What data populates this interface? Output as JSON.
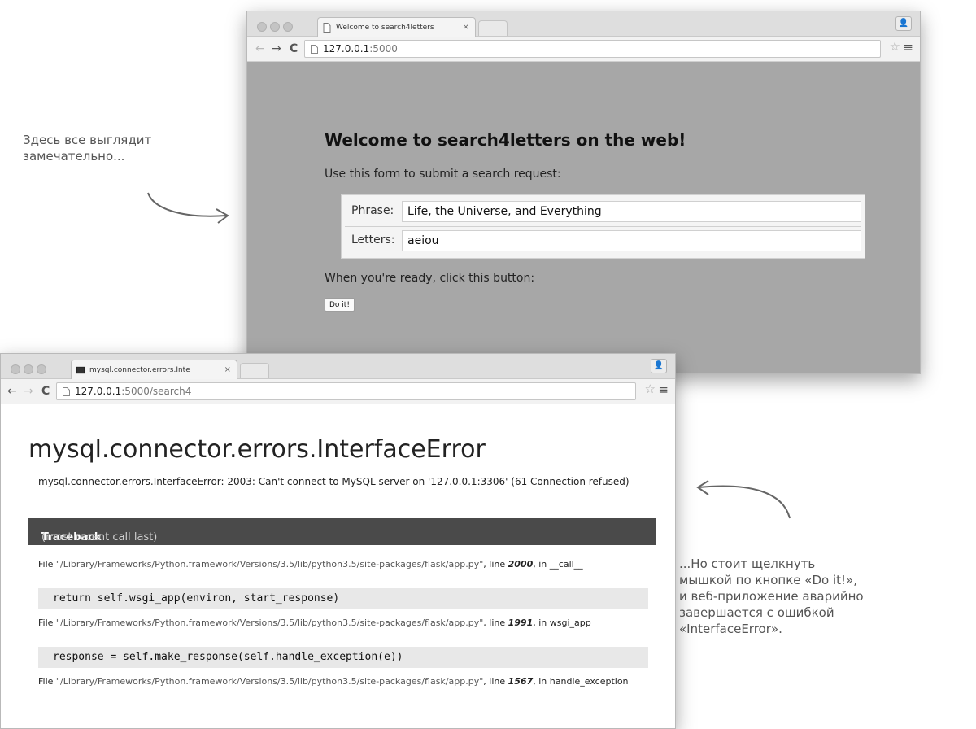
{
  "annotations": {
    "top_note": [
      "Здесь все выглядит",
      "замечательно..."
    ],
    "bottom_note": [
      "...Но стоит щелкнуть",
      "мышкой по кнопке «Do it!»,",
      "и веб-приложение аварийно",
      "завершается с ошибкой",
      "«InterfaceError»."
    ]
  },
  "window_top": {
    "tab_title": "Welcome to search4letters",
    "tab_close": "×",
    "url_host": "127.0.0.1",
    "url_port": ":5000",
    "heading": "Welcome to search4letters on the web!",
    "intro": "Use this form to submit a search request:",
    "phrase_label": "Phrase:",
    "phrase_value": "Life, the Universe, and Everything",
    "letters_label": "Letters:",
    "letters_value": "aeiou",
    "ready_text": "When you're ready, click this button:",
    "button_label": "Do it!"
  },
  "window_error": {
    "tab_title": "mysql.connector.errors.Inte",
    "tab_close": "×",
    "url_host": "127.0.0.1",
    "url_rest": ":5000/search4",
    "error_title": "mysql.connector.errors.InterfaceError",
    "error_message": "mysql.connector.errors.InterfaceError: 2003: Can't connect to MySQL server on '127.0.0.1:3306' (61 Connection refused)",
    "traceback_label": "Traceback",
    "traceback_note": "(most recent call last)",
    "frames": [
      {
        "file_prefix": "File",
        "path": "\"/Library/Frameworks/Python.framework/Versions/3.5/lib/python3.5/site-packages/flask/app.py\"",
        "line_prefix": ", line",
        "line": "2000",
        "func_prefix": ", in",
        "func": "__call__",
        "code": "return self.wsgi_app(environ, start_response)"
      },
      {
        "file_prefix": "File",
        "path": "\"/Library/Frameworks/Python.framework/Versions/3.5/lib/python3.5/site-packages/flask/app.py\"",
        "line_prefix": ", line",
        "line": "1991",
        "func_prefix": ", in",
        "func": "wsgi_app",
        "code": "response = self.make_response(self.handle_exception(e))"
      },
      {
        "file_prefix": "File",
        "path": "\"/Library/Frameworks/Python.framework/Versions/3.5/lib/python3.5/site-packages/flask/app.py\"",
        "line_prefix": ", line",
        "line": "1567",
        "func_prefix": ", in",
        "func": "handle_exception",
        "code": ""
      }
    ]
  },
  "icons": {
    "profile": "person-icon",
    "star": "☆",
    "menu": "≡",
    "back": "←",
    "forward": "→",
    "reload": "C"
  },
  "colors": {
    "page_bg_top_window": "#a7a7a7",
    "traceback_header": "#4a4a4a",
    "code_bg": "#e8e8e8",
    "annotation": "#555555"
  }
}
